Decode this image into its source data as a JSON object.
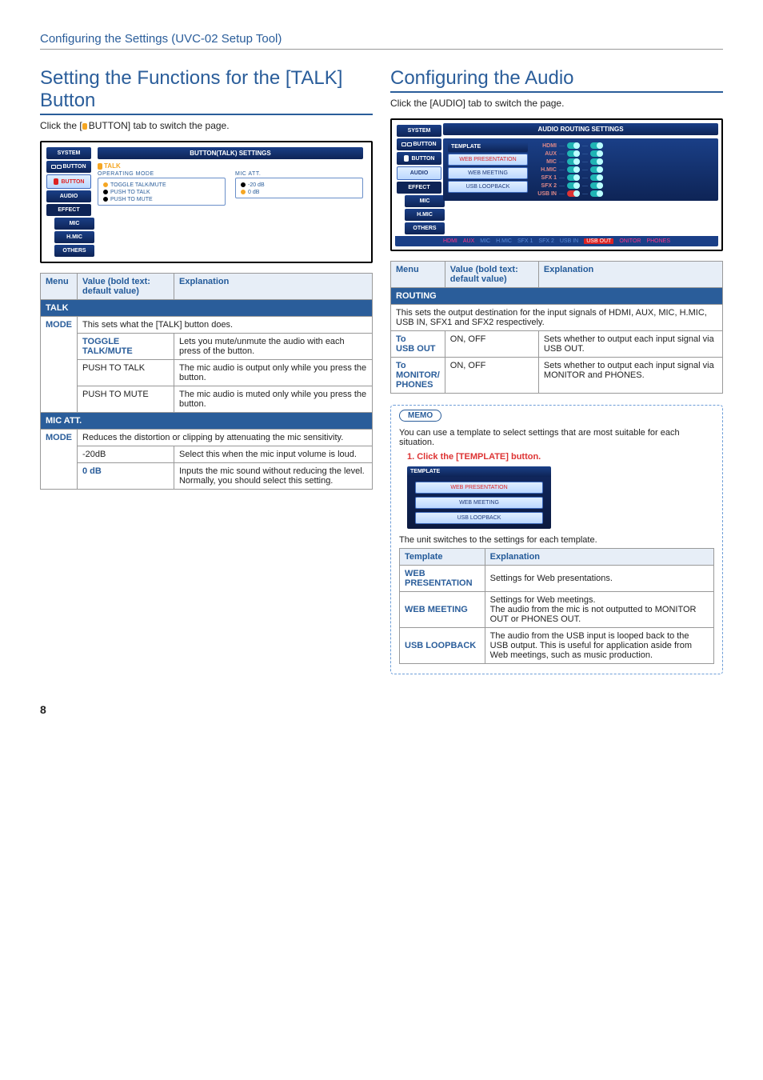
{
  "page_header": "Configuring the Settings (UVC-02 Setup Tool)",
  "page_num": "8",
  "sidebar": [
    "SYSTEM",
    "BUTTON",
    "BUTTON",
    "AUDIO",
    "EFFECT",
    "MIC",
    "H.MIC",
    "OTHERS"
  ],
  "left": {
    "title": "Setting the Functions for the [TALK] Button",
    "lead": "Click the [  BUTTON] tab to switch the page.",
    "shot": {
      "panel_title": "BUTTON(TALK) SETTINGS",
      "talk_tag": "TALK",
      "op_label": "OPERATING MODE",
      "op_opts": [
        "TOGGLE TALK/MUTE",
        "PUSH TO TALK",
        "PUSH TO MUTE"
      ],
      "att_label": "MIC ATT.",
      "att_opts": [
        "-20 dB",
        "0 dB"
      ]
    },
    "table": {
      "head": [
        "Menu",
        "Value (bold text: default value)",
        "Explanation"
      ],
      "talk_bar": "TALK",
      "talk_desc": "This sets what the [TALK] button does.",
      "r1": {
        "menu": "MODE",
        "val": "TOGGLE TALK/MUTE",
        "exp": "Lets you mute/unmute the audio with each press of the button."
      },
      "r2": {
        "val": "PUSH TO TALK",
        "exp": "The mic audio is output only while you press the button."
      },
      "r3": {
        "val": "PUSH TO MUTE",
        "exp": "The mic audio is muted only while you press the button."
      },
      "att_bar": "MIC ATT.",
      "att_desc": "Reduces the distortion or clipping by attenuating the mic sensitivity.",
      "r4": {
        "menu": "MODE",
        "val": "-20dB",
        "exp": "Select this when the mic input volume is loud."
      },
      "r5": {
        "val": "0 dB",
        "exp": "Inputs the mic sound without reducing the level. Normally, you should select this setting."
      }
    }
  },
  "right": {
    "title": "Configuring the Audio",
    "lead": "Click the [AUDIO] tab to switch the page.",
    "shot": {
      "panel_title": "AUDIO ROUTING SETTINGS",
      "template_head": "TEMPLATE",
      "tmpl_opts": [
        "WEB PRESENTATION",
        "WEB MEETING",
        "USB LOOPBACK"
      ],
      "rows": [
        "HDMI",
        "AUX",
        "MIC",
        "H.MIC",
        "SFX 1",
        "SFX 2",
        "USB IN"
      ],
      "bar": [
        "HDMI",
        "AUX",
        "MIC",
        "H.MIC",
        "SFX 1",
        "SFX 2",
        "USB IN",
        "USB OUT",
        "ONITOR",
        "PHONES"
      ]
    },
    "table": {
      "head": [
        "Menu",
        "Value (bold text: default value)",
        "Explanation"
      ],
      "routing_bar": "ROUTING",
      "routing_desc": "This sets the output destination for the input signals of HDMI, AUX, MIC, H.MIC, USB IN, SFX1 and SFX2 respectively.",
      "r1": {
        "menu": "To\nUSB OUT",
        "val": "ON, OFF",
        "exp": "Sets whether to output each input signal via USB OUT."
      },
      "r2": {
        "menu": "To\nMONITOR/\nPHONES",
        "val": "ON, OFF",
        "exp": "Sets whether to output each input signal via MONITOR and PHONES."
      }
    },
    "memo": {
      "tag": "MEMO",
      "text": "You can use a template to select settings that are most suitable for each situation.",
      "step": "1.  Click the [TEMPLATE] button.",
      "after_shot": "The unit switches to the settings for each template.",
      "tmpl_head": [
        "Template",
        "Explanation"
      ],
      "t1": {
        "k": "WEB PRESENTATION",
        "v": "Settings for Web presentations."
      },
      "t2": {
        "k": "WEB MEETING",
        "v": "Settings for Web meetings.\nThe audio from the mic is not outputted to MONITOR OUT or PHONES OUT."
      },
      "t3": {
        "k": "USB LOOPBACK",
        "v": "The audio from the USB input is looped back to the USB output. This is useful for application aside from Web meetings, such as music production."
      }
    }
  },
  "chart_data": {
    "type": "table",
    "title": "AUDIO ROUTING SETTINGS – default toggle states (template: WEB PRESENTATION)",
    "columns": [
      "input",
      "USB OUT",
      "MONITOR/PHONES"
    ],
    "rows": [
      {
        "input": "HDMI",
        "USB OUT": "ON",
        "MONITOR/PHONES": "ON"
      },
      {
        "input": "AUX",
        "USB OUT": "ON",
        "MONITOR/PHONES": "ON"
      },
      {
        "input": "MIC",
        "USB OUT": "ON",
        "MONITOR/PHONES": "ON"
      },
      {
        "input": "H.MIC",
        "USB OUT": "ON",
        "MONITOR/PHONES": "ON"
      },
      {
        "input": "SFX 1",
        "USB OUT": "ON",
        "MONITOR/PHONES": "ON"
      },
      {
        "input": "SFX 2",
        "USB OUT": "ON",
        "MONITOR/PHONES": "ON"
      },
      {
        "input": "USB IN",
        "USB OUT": "OFF",
        "MONITOR/PHONES": "ON"
      }
    ]
  }
}
